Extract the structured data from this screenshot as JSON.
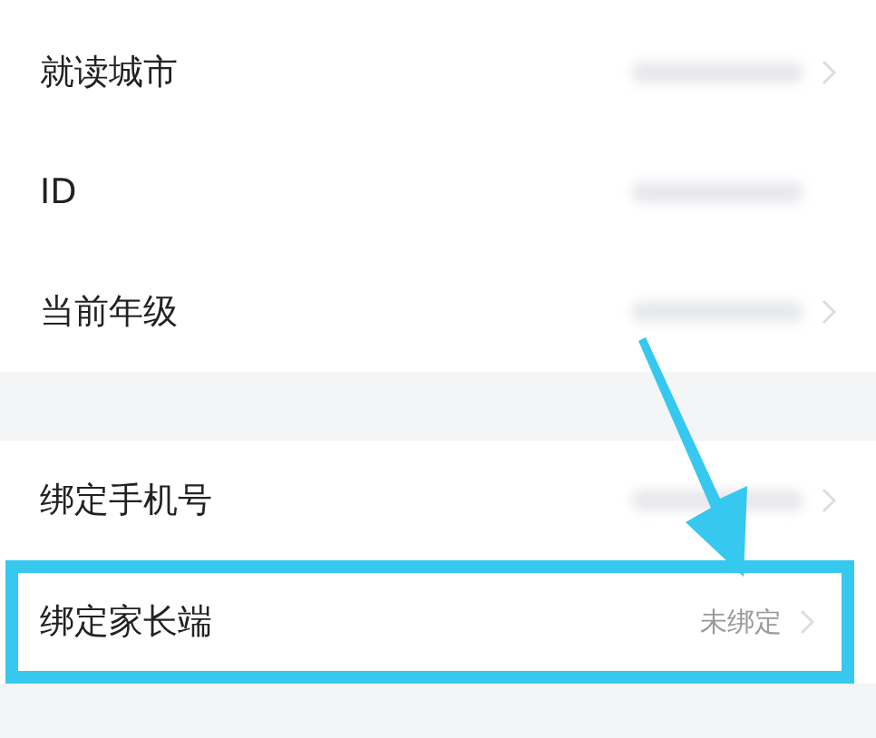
{
  "sections": [
    {
      "rows": [
        {
          "label": "就读城市",
          "kind": "masked",
          "chevron": true,
          "highlighted": false
        },
        {
          "label": "ID",
          "kind": "masked",
          "chevron": false,
          "highlighted": false
        },
        {
          "label": "当前年级",
          "kind": "masked",
          "chevron": true,
          "highlighted": false
        }
      ]
    },
    {
      "rows": [
        {
          "label": "绑定手机号",
          "kind": "masked",
          "chevron": true,
          "highlighted": false
        },
        {
          "label": "绑定家长端",
          "kind": "text",
          "value": "未绑定",
          "chevron": true,
          "highlighted": true
        }
      ]
    }
  ]
}
